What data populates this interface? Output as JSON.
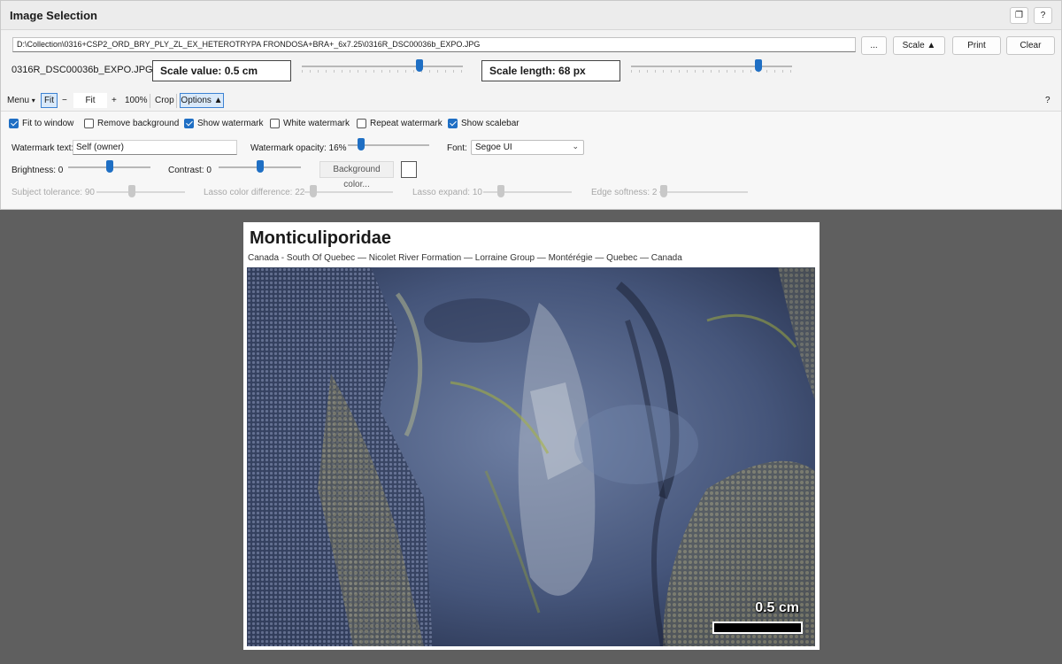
{
  "window": {
    "title": "Image Selection",
    "buttons": {
      "restore_label": "❐",
      "help_label": "?"
    }
  },
  "file": {
    "path": "D:\\Collection\\0316+CSP2_ORD_BRY_PLY_ZL_EX_HETEROTRYPA FRONDOSA+BRA+_6x7.25\\0316R_DSC00036b_EXPO.JPG",
    "browse_label": "...",
    "scale_button_label": "Scale ▲",
    "print_label": "Print",
    "clear_label": "Clear",
    "name": "0316R_DSC00036b_EXPO.JPG"
  },
  "scale": {
    "value_text": "Scale value: 0.5 cm",
    "value_slider": 0.73,
    "length_text": "Scale length: 68 px",
    "length_slider": 0.79
  },
  "toolbar": {
    "menu_label": "Menu",
    "menu_caret": "▾",
    "fit_label": "Fit",
    "zoom_out_label": "−",
    "fit_value": "Fit",
    "zoom_in_label": "+",
    "hundred_label": "100%",
    "crop_label": "Crop",
    "options_label": "Options ▲",
    "help_label": "?"
  },
  "options": {
    "checkboxes": [
      {
        "label": "Fit to window",
        "checked": true
      },
      {
        "label": "Remove background",
        "checked": false
      },
      {
        "label": "Show watermark",
        "checked": true
      },
      {
        "label": "White watermark",
        "checked": false
      },
      {
        "label": "Repeat watermark",
        "checked": false
      },
      {
        "label": "Show scalebar",
        "checked": true
      }
    ],
    "watermark_text_label": "Watermark text:",
    "watermark_text_value": "Self (owner)",
    "watermark_opacity_label": "Watermark opacity: 16%",
    "watermark_opacity": 0.16,
    "font_label": "Font:",
    "font_value": "Segoe UI",
    "brightness_label": "Brightness: 0",
    "brightness": 0.5,
    "contrast_label": "Contrast: 0",
    "contrast": 0.5,
    "background_color_label": "Background color...",
    "background_color": "#ffffff",
    "subject_tolerance_label": "Subject tolerance: 90",
    "subject_tolerance": 0.4,
    "lasso_color_label": "Lasso color difference: 22",
    "lasso_color": 0.1,
    "lasso_expand_label": "Lasso expand: 10",
    "lasso_expand": 0.2,
    "edge_softness_label": "Edge softness: 2",
    "edge_softness": 0.05
  },
  "preview": {
    "title": "Monticuliporidae",
    "subtitle": "Canada - South Of Quebec — Nicolet River Formation — Lorraine Group — Montérégie — Quebec — Canada",
    "scalebar_label": "0.5 cm"
  },
  "colors": {
    "accent": "#1f6fc4",
    "canvas_background": "#5f5f5f"
  }
}
